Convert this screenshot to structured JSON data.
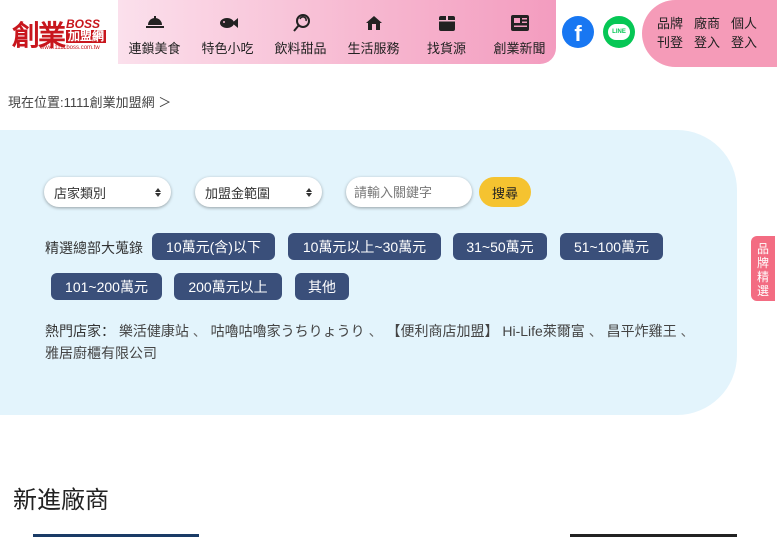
{
  "logo": {
    "main": "創業",
    "boss": "BOSS",
    "sub": "加盟網",
    "url": "www.1111boss.com.tw"
  },
  "nav": [
    {
      "label": "連鎖美食",
      "icon": "food-cover-icon"
    },
    {
      "label": "特色小吃",
      "icon": "fish-icon"
    },
    {
      "label": "飲料甜品",
      "icon": "lollipop-icon"
    },
    {
      "label": "生活服務",
      "icon": "home-icon"
    },
    {
      "label": "找貨源",
      "icon": "box-icon"
    },
    {
      "label": "創業新聞",
      "icon": "newspaper-icon"
    }
  ],
  "social": {
    "facebook": "f",
    "line": "LINE"
  },
  "login": [
    "品牌刊登",
    "廠商登入",
    "個人登入"
  ],
  "breadcrumb": "現在位置:1111創業加盟網 ＞",
  "search": {
    "store_type": "店家類別",
    "budget_range": "加盟金範圍",
    "keyword_placeholder": "請輸入關鍵字",
    "button": "搜尋"
  },
  "budget": {
    "label": "精選總部大蒐錄",
    "chips": [
      "10萬元(含)以下",
      "10萬元以上~30萬元",
      "31~50萬元",
      "51~100萬元",
      "101~200萬元",
      "200萬元以上",
      "其他"
    ]
  },
  "hot_stores": {
    "label": "熱門店家：",
    "items": [
      "樂活健康站",
      "咕嚕咕嚕家うちりょうり",
      "【便利商店加盟】 Hi-Life萊爾富",
      "昌平炸雞王",
      "雅居廚櫃有限公司"
    ],
    "separator": "、"
  },
  "side_tab": "品牌精選",
  "new_vendors_title": "新進廠商",
  "colors": {
    "nav_pink": "#f7b9d1",
    "login_pink": "#f59bb8",
    "panel_blue": "#e3f4fc",
    "chip_navy": "#3a4f7a",
    "search_yellow": "#f5c330",
    "brand_red": "#c8161d"
  }
}
